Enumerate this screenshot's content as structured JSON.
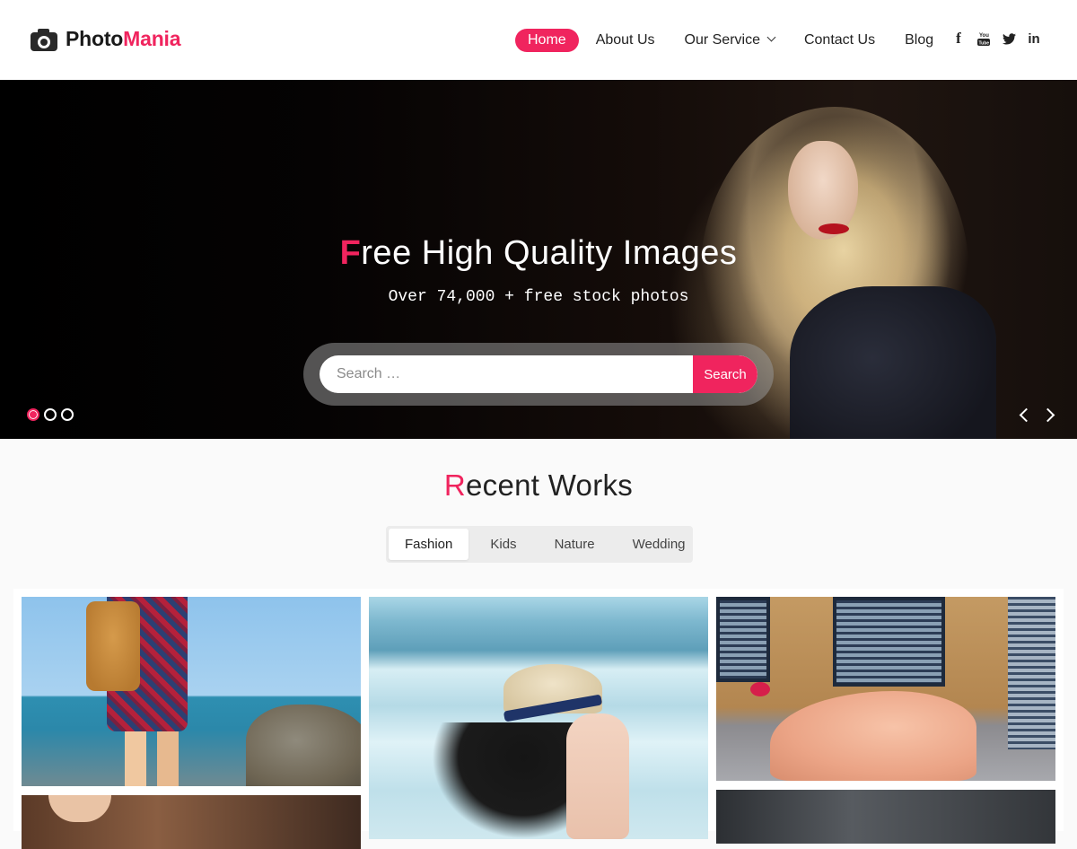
{
  "header": {
    "logo": {
      "icon": "camera-icon",
      "brand_part1": "Photo",
      "brand_part2": "Mania"
    },
    "nav": [
      {
        "label": "Home",
        "active": true
      },
      {
        "label": "About Us",
        "active": false
      },
      {
        "label": "Our Service",
        "active": false,
        "has_dropdown": true
      },
      {
        "label": "Contact Us",
        "active": false
      },
      {
        "label": "Blog",
        "active": false
      }
    ],
    "social": [
      {
        "name": "facebook-icon",
        "glyph": "f"
      },
      {
        "name": "youtube-icon",
        "glyph": "▣"
      },
      {
        "name": "twitter-icon",
        "glyph": "🐦"
      },
      {
        "name": "linkedin-icon",
        "glyph": "in"
      }
    ]
  },
  "hero": {
    "title_first_letter": "F",
    "title_rest": "ree High Quality Images",
    "subtitle": "Over 74,000 + free stock photos",
    "search": {
      "placeholder": "Search …",
      "value": "",
      "button_label": "Search"
    },
    "slider": {
      "total_slides": 3,
      "active_slide": 1
    }
  },
  "recent_works": {
    "title_first_letter": "R",
    "title_rest": "ecent Works",
    "tabs": [
      {
        "label": "Fashion",
        "active": true
      },
      {
        "label": "Kids",
        "active": false
      },
      {
        "label": "Nature",
        "active": false
      },
      {
        "label": "Wedding",
        "active": false
      }
    ],
    "photos": [
      {
        "name": "photo-girl-backpack-seaside"
      },
      {
        "name": "photo-hair-closeup"
      },
      {
        "name": "photo-woman-straw-hat-beach"
      },
      {
        "name": "photo-bride-pink-gown"
      },
      {
        "name": "photo-city-street"
      }
    ]
  },
  "colors": {
    "accent": "#f0245e",
    "text": "#222222",
    "background": "#fafafa"
  }
}
